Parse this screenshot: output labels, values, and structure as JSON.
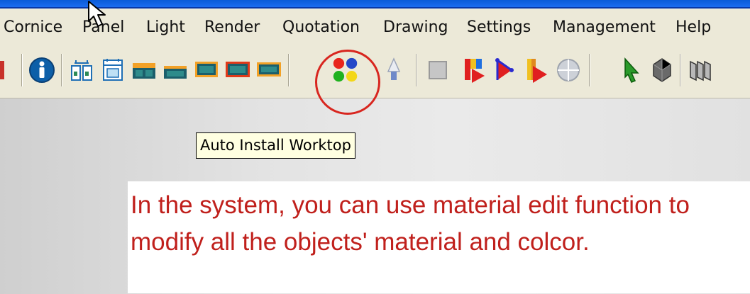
{
  "menu": [
    "Cornice",
    "Panel",
    "Light",
    "Render",
    "Quotation",
    "Drawing",
    "Settings",
    "Management",
    "Help"
  ],
  "toolbar": {
    "icons": [
      "info-icon",
      "cabinet-pair-icon",
      "tall-cabinet-icon",
      "base-cabinet-icon",
      "wall-cabinet-icon",
      "sink-cabinet-icon",
      "hob-cabinet-icon",
      "auto-install-worktop-icon",
      "lamp-icon",
      "blank-icon",
      "render-flag-icon",
      "render-path-icon",
      "render-gradient-icon",
      "sphere-icon",
      "pointer-icon",
      "solid-icon",
      "panels-icon"
    ],
    "hovered": "auto-install-worktop-icon"
  },
  "tooltip": "Auto Install Worktop",
  "instruction": "In the system, you can use material edit function to\nmodify all the objects' material and colcor.",
  "colors": {
    "title_bar": "#1b6cf0",
    "toolbar_bg": "#ece9d8",
    "highlight": "#d8261f",
    "instruction_text": "#c0201c"
  }
}
